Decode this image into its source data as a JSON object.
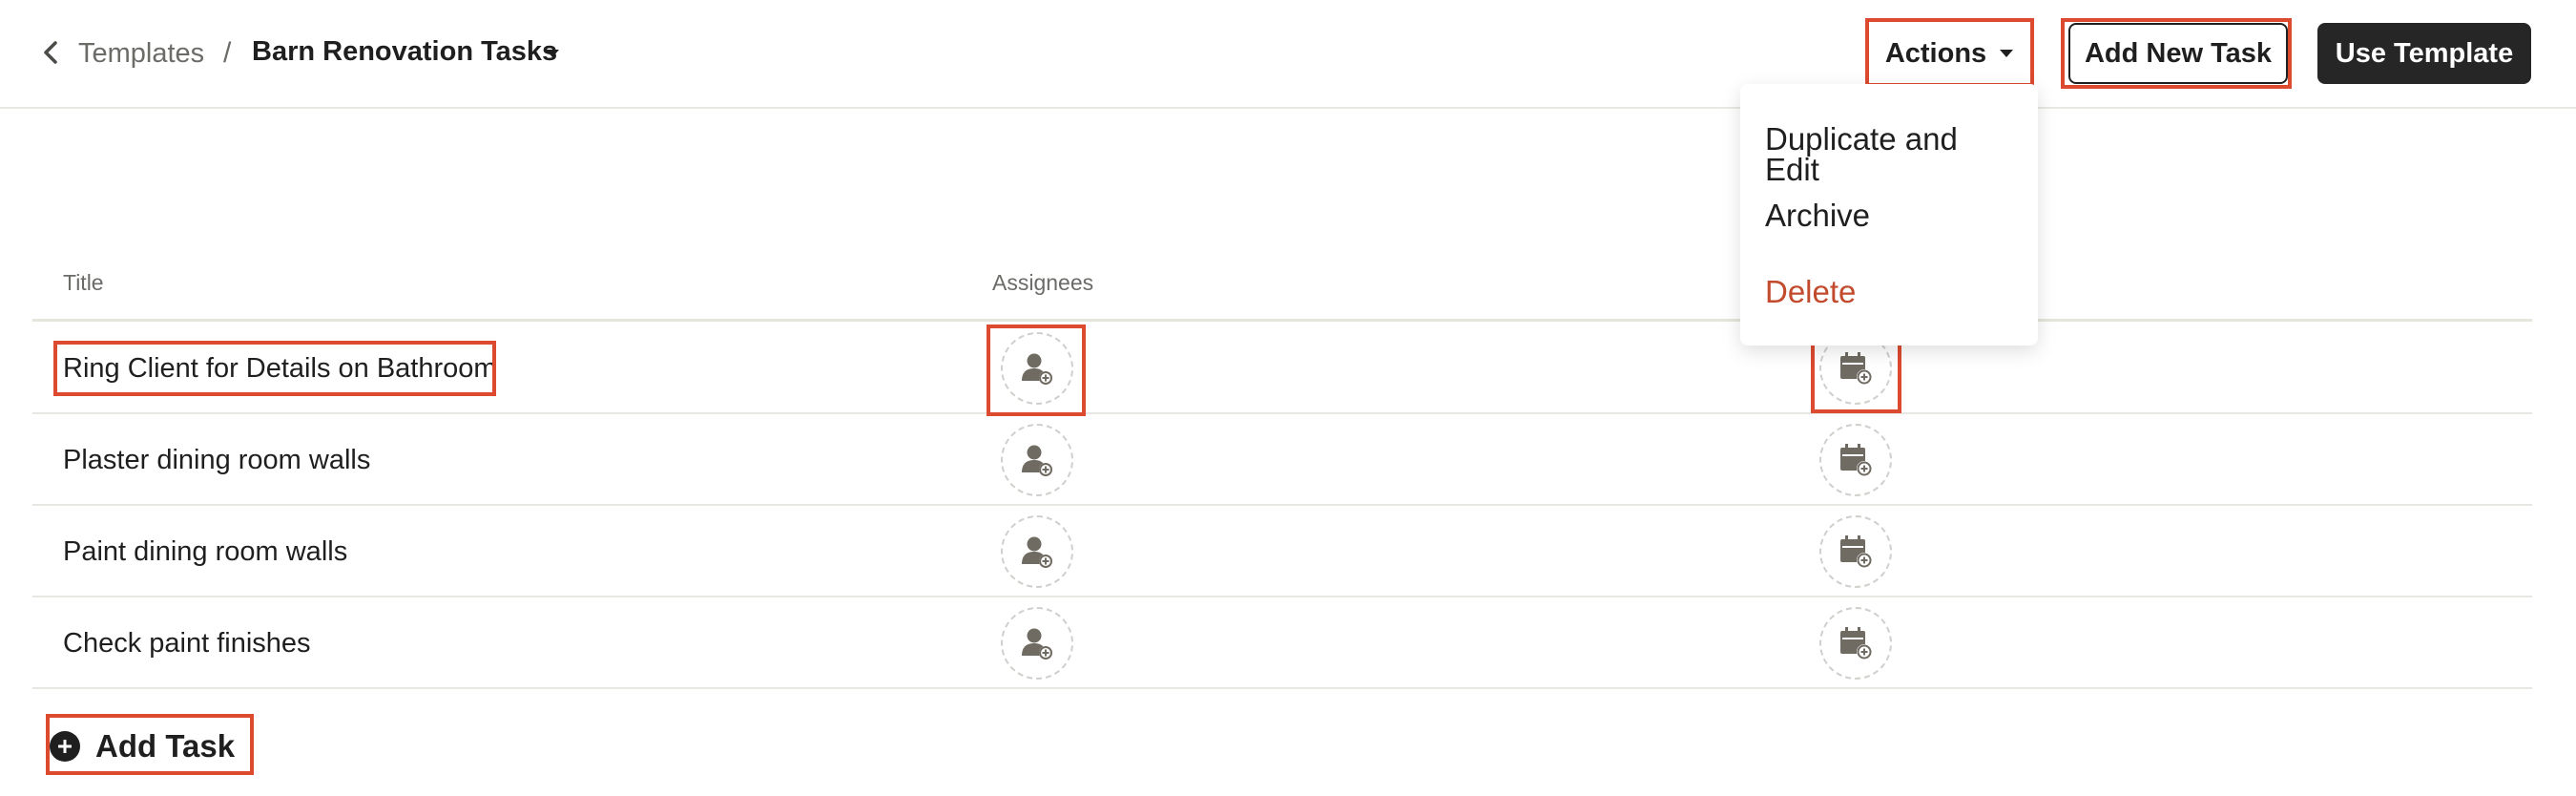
{
  "breadcrumb": {
    "parent": "Templates",
    "separator": "/",
    "current": "Barn Renovation Tasks"
  },
  "header": {
    "actions_label": "Actions",
    "add_new_task_label": "Add New Task",
    "use_template_label": "Use Template"
  },
  "actions_menu": {
    "items": [
      {
        "label": "Duplicate and Edit"
      },
      {
        "label": "Archive"
      },
      {
        "label": "Delete"
      }
    ]
  },
  "table": {
    "columns": [
      "Title",
      "Assignees"
    ],
    "rows": [
      {
        "title": "Ring Client for Details on Bathroom"
      },
      {
        "title": "Plaster dining room walls"
      },
      {
        "title": "Paint dining room walls"
      },
      {
        "title": "Check paint finishes"
      }
    ]
  },
  "footer": {
    "add_task_label": "Add Task"
  },
  "colors": {
    "accent_highlight": "#dc4a30",
    "danger": "#c24a2d",
    "dark_button": "#262626",
    "icon_gray": "#6f6b62"
  }
}
